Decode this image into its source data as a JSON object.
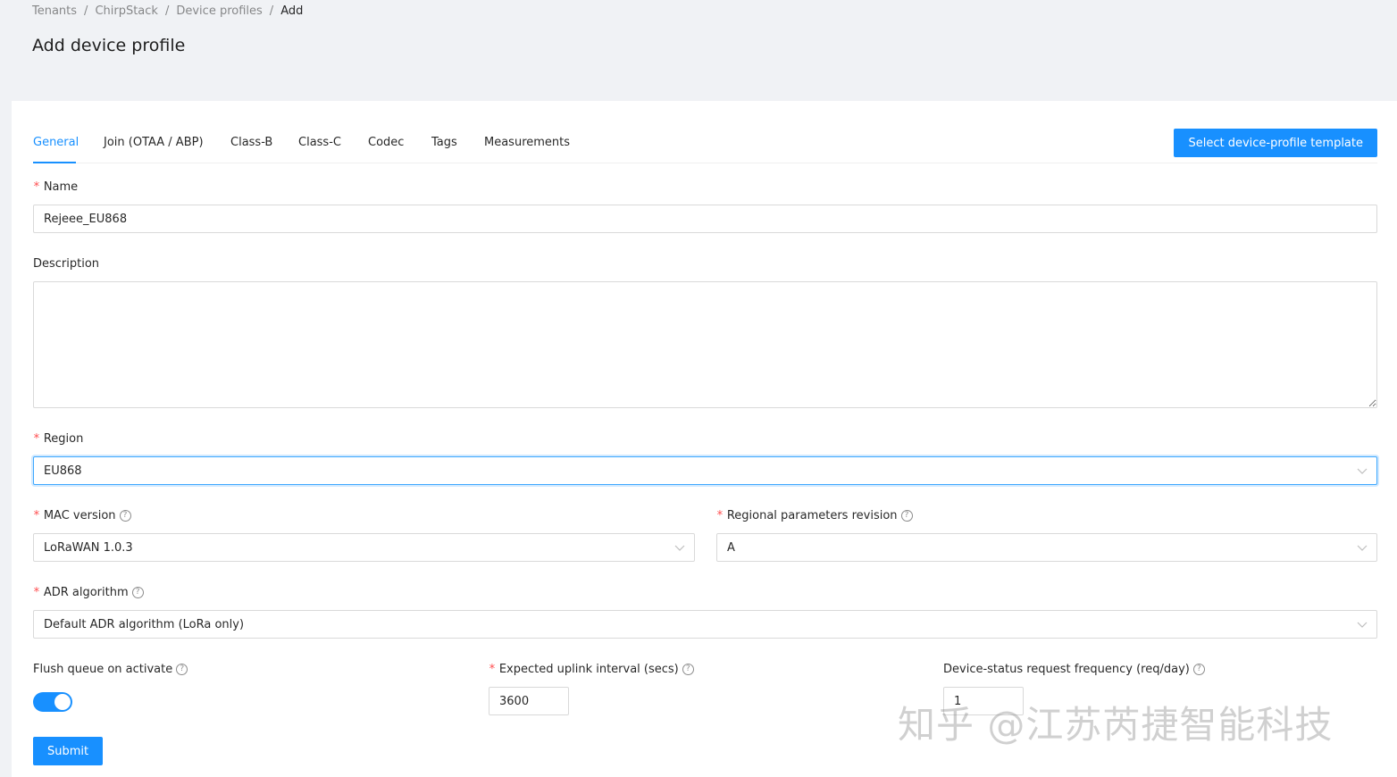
{
  "breadcrumb": {
    "items": [
      "Tenants",
      "ChirpStack",
      "Device profiles"
    ],
    "current": "Add",
    "separator": "/"
  },
  "page": {
    "title": "Add device profile"
  },
  "tabs": [
    {
      "label": "General",
      "active": true
    },
    {
      "label": "Join (OTAA / ABP)"
    },
    {
      "label": "Class-B"
    },
    {
      "label": "Class-C"
    },
    {
      "label": "Codec"
    },
    {
      "label": "Tags"
    },
    {
      "label": "Measurements"
    }
  ],
  "template_button": "Select device-profile template",
  "form": {
    "name": {
      "label": "Name",
      "value": "Rejeee_EU868",
      "required": true
    },
    "description": {
      "label": "Description",
      "value": ""
    },
    "region": {
      "label": "Region",
      "value": "EU868",
      "required": true
    },
    "mac_version": {
      "label": "MAC version",
      "value": "LoRaWAN 1.0.3",
      "required": true
    },
    "regional_params": {
      "label": "Regional parameters revision",
      "value": "A",
      "required": true
    },
    "adr": {
      "label": "ADR algorithm",
      "value": "Default ADR algorithm (LoRa only)",
      "required": true
    },
    "flush_queue": {
      "label": "Flush queue on activate",
      "enabled": true
    },
    "uplink_interval": {
      "label": "Expected uplink interval (secs)",
      "value": "3600",
      "required": true
    },
    "status_freq": {
      "label": "Device-status request frequency (req/day)",
      "value": "1"
    },
    "submit": "Submit"
  },
  "watermark": "知乎 @江苏芮捷智能科技",
  "colors": {
    "primary": "#1890ff",
    "required": "#ff4d4f",
    "background": "#f0f2f5"
  },
  "icons": {
    "help": "question-circle-icon",
    "select": "chevron-down-icon"
  }
}
